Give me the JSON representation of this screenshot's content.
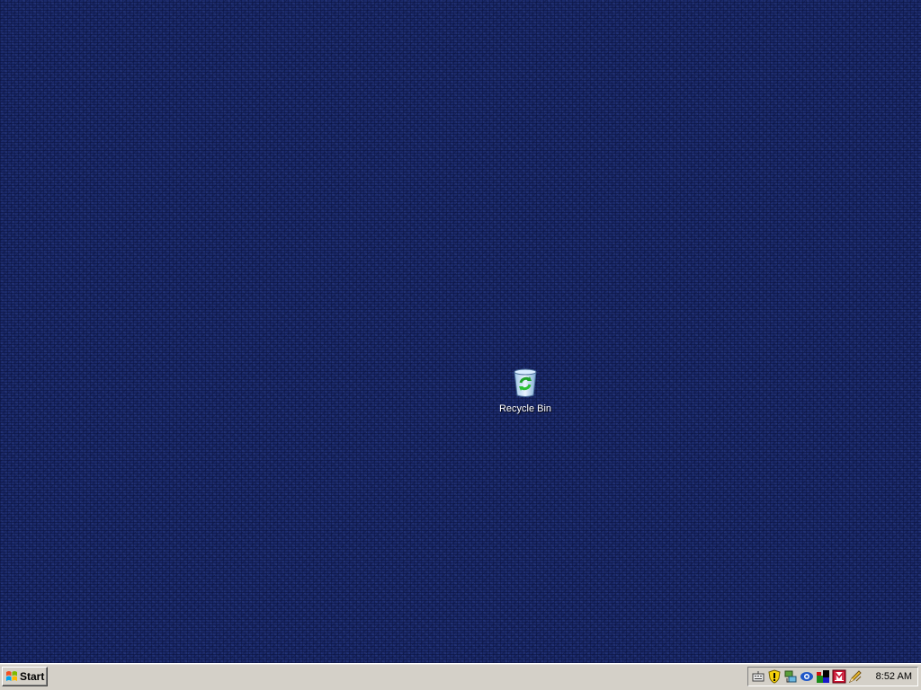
{
  "desktop": {
    "background_color": "#1b2a6b",
    "icons": [
      {
        "label": "Recycle Bin",
        "icon": "recycle-bin-icon"
      }
    ]
  },
  "taskbar": {
    "background_color": "#d4d0c8",
    "start_button": {
      "label": "Start",
      "icon": "windows-logo-icon"
    },
    "tray": {
      "icons": [
        "keyboard-icon",
        "security-shield-icon",
        "network-icon",
        "messenger-icon",
        "color-blocks-icon",
        "mcafee-icon",
        "pencil-icon"
      ],
      "clock": "8:52 AM"
    }
  }
}
